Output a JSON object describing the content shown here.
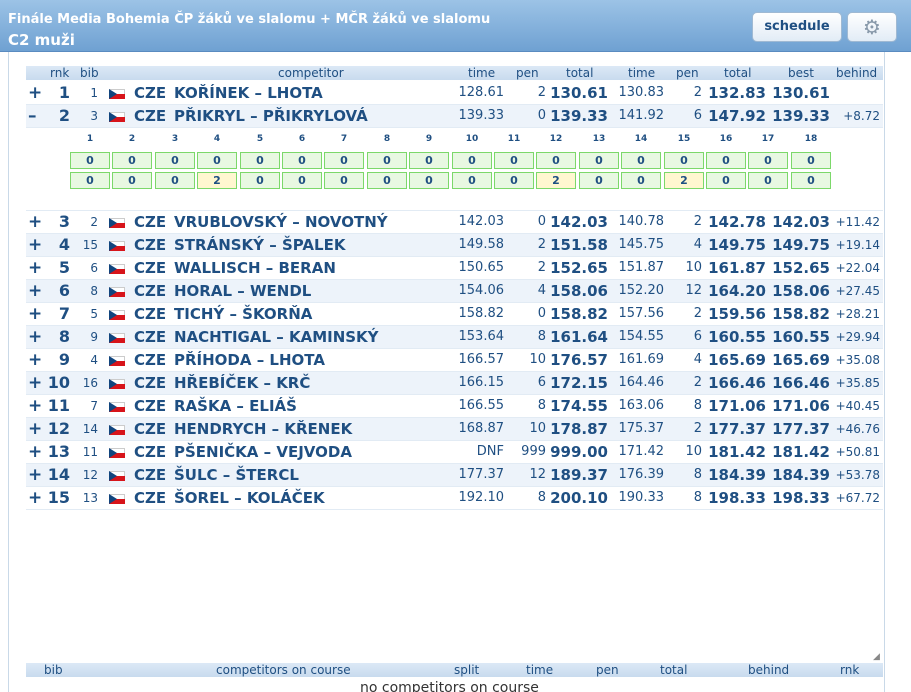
{
  "header": {
    "title": "Finále Media Bohemia ČP žáků ve slalomu + MČR žáků ve slalomu",
    "subtitle": "C2 muži",
    "schedule_label": "schedule",
    "settings_icon": "gear-icon"
  },
  "columns": {
    "rnk": "rnk",
    "bib": "bib",
    "competitor": "competitor",
    "time1": "time",
    "pen1": "pen",
    "total1": "total",
    "time2": "time",
    "pen2": "pen",
    "total2": "total",
    "best": "best",
    "behind": "behind"
  },
  "rows": [
    {
      "toggle": "+",
      "rnk": "1",
      "bib": "1",
      "nat": "CZE",
      "name": "KOŘÍNEK – LHOTA",
      "t1": "128.61",
      "p1": "2",
      "tot1": "130.61",
      "t2": "130.83",
      "p2": "2",
      "tot2": "132.83",
      "best": "130.61",
      "behind": ""
    },
    {
      "toggle": "–",
      "rnk": "2",
      "bib": "3",
      "nat": "CZE",
      "name": "PŘIKRYL – PŘIKRYLOVÁ",
      "t1": "139.33",
      "p1": "0",
      "tot1": "139.33",
      "t2": "141.92",
      "p2": "6",
      "tot2": "147.92",
      "best": "139.33",
      "behind": "+8.72"
    },
    {
      "toggle": "+",
      "rnk": "3",
      "bib": "2",
      "nat": "CZE",
      "name": "VRUBLOVSKÝ – NOVOTNÝ",
      "t1": "142.03",
      "p1": "0",
      "tot1": "142.03",
      "t2": "140.78",
      "p2": "2",
      "tot2": "142.78",
      "best": "142.03",
      "behind": "+11.42"
    },
    {
      "toggle": "+",
      "rnk": "4",
      "bib": "15",
      "nat": "CZE",
      "name": "STRÁNSKÝ – ŠPALEK",
      "t1": "149.58",
      "p1": "2",
      "tot1": "151.58",
      "t2": "145.75",
      "p2": "4",
      "tot2": "149.75",
      "best": "149.75",
      "behind": "+19.14"
    },
    {
      "toggle": "+",
      "rnk": "5",
      "bib": "6",
      "nat": "CZE",
      "name": "WALLISCH – BERAN",
      "t1": "150.65",
      "p1": "2",
      "tot1": "152.65",
      "t2": "151.87",
      "p2": "10",
      "tot2": "161.87",
      "best": "152.65",
      "behind": "+22.04"
    },
    {
      "toggle": "+",
      "rnk": "6",
      "bib": "8",
      "nat": "CZE",
      "name": "HORAL – WENDL",
      "t1": "154.06",
      "p1": "4",
      "tot1": "158.06",
      "t2": "152.20",
      "p2": "12",
      "tot2": "164.20",
      "best": "158.06",
      "behind": "+27.45"
    },
    {
      "toggle": "+",
      "rnk": "7",
      "bib": "5",
      "nat": "CZE",
      "name": "TICHÝ – ŠKORŇA",
      "t1": "158.82",
      "p1": "0",
      "tot1": "158.82",
      "t2": "157.56",
      "p2": "2",
      "tot2": "159.56",
      "best": "158.82",
      "behind": "+28.21"
    },
    {
      "toggle": "+",
      "rnk": "8",
      "bib": "9",
      "nat": "CZE",
      "name": "NACHTIGAL – KAMINSKÝ",
      "t1": "153.64",
      "p1": "8",
      "tot1": "161.64",
      "t2": "154.55",
      "p2": "6",
      "tot2": "160.55",
      "best": "160.55",
      "behind": "+29.94"
    },
    {
      "toggle": "+",
      "rnk": "9",
      "bib": "4",
      "nat": "CZE",
      "name": "PŘÍHODA – LHOTA",
      "t1": "166.57",
      "p1": "10",
      "tot1": "176.57",
      "t2": "161.69",
      "p2": "4",
      "tot2": "165.69",
      "best": "165.69",
      "behind": "+35.08"
    },
    {
      "toggle": "+",
      "rnk": "10",
      "bib": "16",
      "nat": "CZE",
      "name": "HŘEBÍČEK – KRČ",
      "t1": "166.15",
      "p1": "6",
      "tot1": "172.15",
      "t2": "164.46",
      "p2": "2",
      "tot2": "166.46",
      "best": "166.46",
      "behind": "+35.85"
    },
    {
      "toggle": "+",
      "rnk": "11",
      "bib": "7",
      "nat": "CZE",
      "name": "RAŠKA – ELIÁŠ",
      "t1": "166.55",
      "p1": "8",
      "tot1": "174.55",
      "t2": "163.06",
      "p2": "8",
      "tot2": "171.06",
      "best": "171.06",
      "behind": "+40.45"
    },
    {
      "toggle": "+",
      "rnk": "12",
      "bib": "14",
      "nat": "CZE",
      "name": "HENDRYCH – KŘENEK",
      "t1": "168.87",
      "p1": "10",
      "tot1": "178.87",
      "t2": "175.37",
      "p2": "2",
      "tot2": "177.37",
      "best": "177.37",
      "behind": "+46.76"
    },
    {
      "toggle": "+",
      "rnk": "13",
      "bib": "11",
      "nat": "CZE",
      "name": "PŠENIČKA – VEJVODA",
      "t1": "DNF",
      "p1": "999",
      "tot1": "999.00",
      "t2": "171.42",
      "p2": "10",
      "tot2": "181.42",
      "best": "181.42",
      "behind": "+50.81"
    },
    {
      "toggle": "+",
      "rnk": "14",
      "bib": "12",
      "nat": "CZE",
      "name": "ŠULC – ŠTERCL",
      "t1": "177.37",
      "p1": "12",
      "tot1": "189.37",
      "t2": "176.39",
      "p2": "8",
      "tot2": "184.39",
      "best": "184.39",
      "behind": "+53.78"
    },
    {
      "toggle": "+",
      "rnk": "15",
      "bib": "13",
      "nat": "CZE",
      "name": "ŠOREL – KOLÁČEK",
      "t1": "192.10",
      "p1": "8",
      "tot1": "200.10",
      "t2": "190.33",
      "p2": "8",
      "tot2": "198.33",
      "best": "198.33",
      "behind": "+67.72"
    }
  ],
  "gates": {
    "numbers": [
      "1",
      "2",
      "3",
      "4",
      "5",
      "6",
      "7",
      "8",
      "9",
      "10",
      "11",
      "12",
      "13",
      "14",
      "15",
      "16",
      "17",
      "18"
    ],
    "run1": [
      "0",
      "0",
      "0",
      "0",
      "0",
      "0",
      "0",
      "0",
      "0",
      "0",
      "0",
      "0",
      "0",
      "0",
      "0",
      "0",
      "0",
      "0"
    ],
    "run2": [
      "0",
      "0",
      "0",
      "2",
      "0",
      "0",
      "0",
      "0",
      "0",
      "0",
      "0",
      "2",
      "0",
      "0",
      "2",
      "0",
      "0",
      "0"
    ]
  },
  "on_course": {
    "columns": {
      "bib": "bib",
      "competitors": "competitors on course",
      "split": "split",
      "time": "time",
      "pen": "pen",
      "total": "total",
      "behind": "behind",
      "rnk": "rnk"
    },
    "empty_text": "no competitors on course"
  },
  "colors": {
    "accent": "#1f4f82",
    "header_bg": "#7aa9d8",
    "gate_ok": "#e8f8e2",
    "gate_pen": "#fff7d0",
    "flag_red": "#d7141a",
    "flag_blue": "#11457e"
  }
}
